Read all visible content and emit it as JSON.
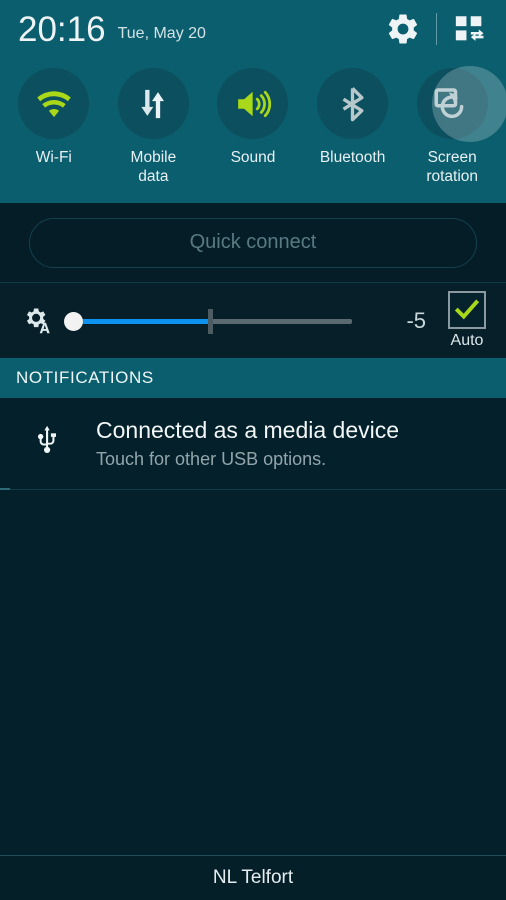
{
  "status_bar": {
    "time": "20:16",
    "date": "Tue, May 20",
    "settings_icon": "gear-icon",
    "edit_icon": "quick-settings-edit-grid-icon"
  },
  "quick_toggles": [
    {
      "label": "Wi-Fi",
      "icon": "wifi-icon",
      "state": "on",
      "accent": "#a8d818"
    },
    {
      "label": "Mobile\ndata",
      "label_line1": "Mobile",
      "label_line2": "data",
      "icon": "mobile-data-arrows-icon",
      "state": "off",
      "accent": "#e6eef0"
    },
    {
      "label": "Sound",
      "icon": "speaker-sound-icon",
      "state": "on",
      "accent": "#a8d818"
    },
    {
      "label": "Bluetooth",
      "icon": "bluetooth-icon",
      "state": "off",
      "accent": "#aebfc4"
    },
    {
      "label": "Screen\nrotation",
      "label_line1": "Screen",
      "label_line2": "rotation",
      "icon": "screen-rotation-icon",
      "state": "off",
      "accent": "#b6c8cd",
      "pressed": true
    }
  ],
  "quick_connect": {
    "label": "Quick connect"
  },
  "brightness": {
    "icon": "auto-brightness-gear-a-icon",
    "value": "-5",
    "auto_label": "Auto",
    "auto_checked": true,
    "slider_fill_color": "#0e93f0",
    "slider_track_color": "#5b6a70",
    "check_color": "#a8d818"
  },
  "notifications": {
    "section_title": "NOTIFICATIONS",
    "items": [
      {
        "icon": "usb-icon",
        "title": "Connected as a media device",
        "subtitle": "Touch for other USB options."
      }
    ]
  },
  "footer": {
    "carrier": "NL Telfort"
  },
  "colors": {
    "header_teal": "#0b5e6e",
    "panel_dark": "#041d27",
    "toggle_circle": "#0c4f5e",
    "green_accent": "#a8d818",
    "blue_slider": "#0e93f0"
  }
}
